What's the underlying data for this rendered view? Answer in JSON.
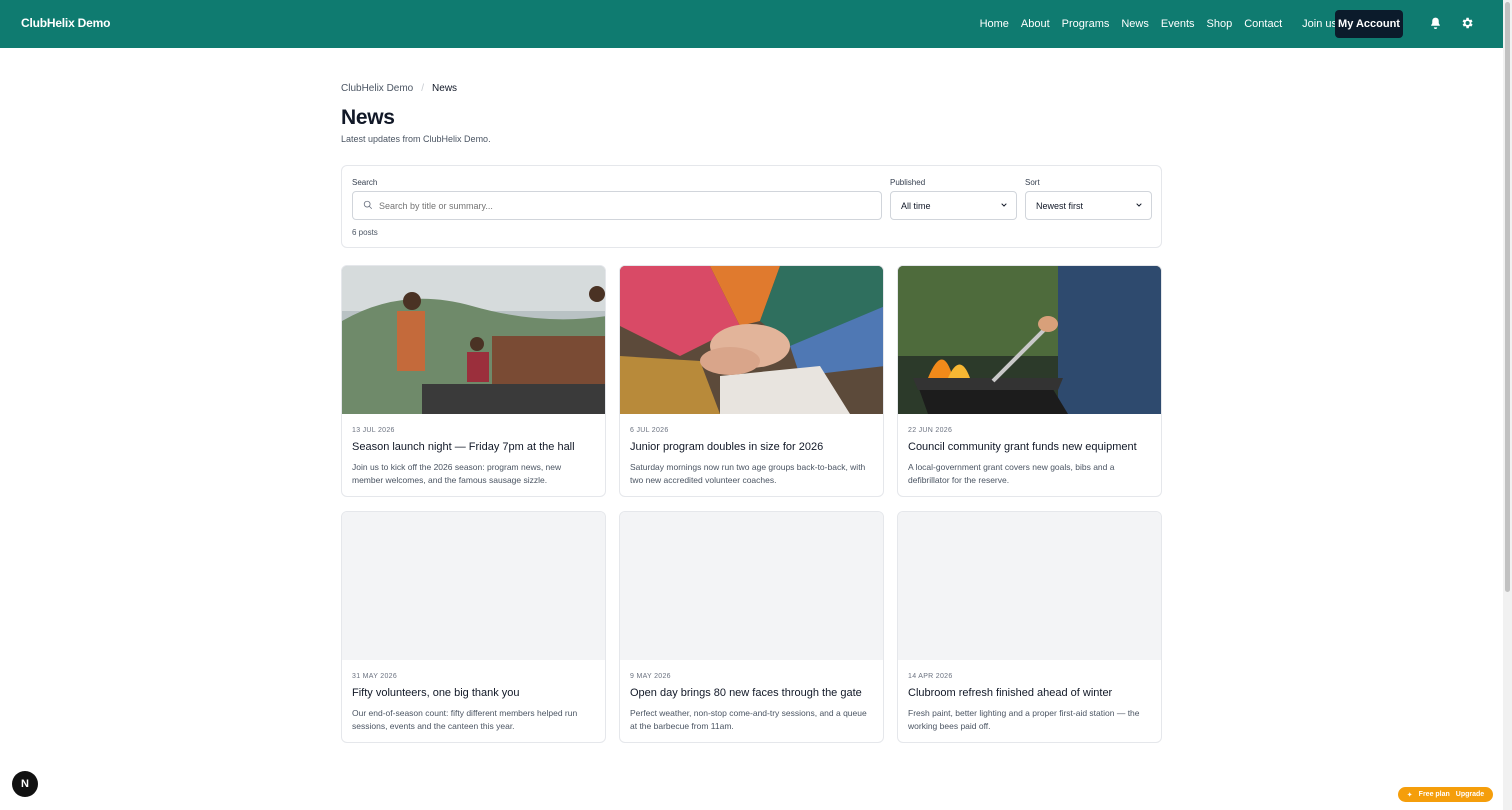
{
  "header": {
    "brand": "ClubHelix Demo",
    "nav": [
      "Home",
      "About",
      "Programs",
      "News",
      "Events",
      "Shop",
      "Contact"
    ],
    "join_label": "Join us",
    "account_label": "My Account"
  },
  "breadcrumb": {
    "root": "ClubHelix Demo",
    "current": "News"
  },
  "page": {
    "title": "News",
    "subtitle": "Latest updates from ClubHelix Demo."
  },
  "filters": {
    "search_label": "Search",
    "search_placeholder": "Search by title or summary...",
    "published_label": "Published",
    "published_value": "All time",
    "sort_label": "Sort",
    "sort_value": "Newest first",
    "count": "6 posts"
  },
  "posts": [
    {
      "date": "13 JUL 2026",
      "title": "Season launch night — Friday 7pm at the hall",
      "summary": "Join us to kick off the 2026 season: program news, new member welcomes, and the famous sausage sizzle."
    },
    {
      "date": "6 JUL 2026",
      "title": "Junior program doubles in size for 2026",
      "summary": "Saturday mornings now run two age groups back-to-back, with two new accredited volunteer coaches."
    },
    {
      "date": "22 JUN 2026",
      "title": "Council community grant funds new equipment",
      "summary": "A local-government grant covers new goals, bibs and a defibrillator for the reserve."
    },
    {
      "date": "31 MAY 2026",
      "title": "Fifty volunteers, one big thank you",
      "summary": "Our end-of-season count: fifty different members helped run sessions, events and the canteen this year."
    },
    {
      "date": "9 MAY 2026",
      "title": "Open day brings 80 new faces through the gate",
      "summary": "Perfect weather, non-stop come-and-try sessions, and a queue at the barbecue from 11am."
    },
    {
      "date": "14 APR 2026",
      "title": "Clubroom refresh finished ahead of winter",
      "summary": "Fresh paint, better lighting and a proper first-aid station — the working bees paid off."
    }
  ],
  "footer": {
    "dev_badge": "N",
    "plan_label": "Free plan",
    "upgrade_label": "Upgrade"
  }
}
